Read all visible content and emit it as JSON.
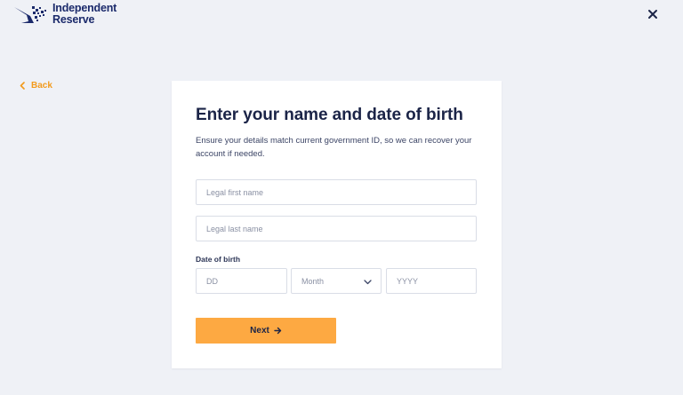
{
  "brand": {
    "name_line1": "Independent",
    "name_line2": "Reserve",
    "logo_icon": "eagle-wing-icon",
    "color": "#1b2a6b"
  },
  "header": {
    "close_icon": "close-icon"
  },
  "nav": {
    "back_label": "Back",
    "back_icon": "chevron-left-icon"
  },
  "form": {
    "title": "Enter your name and date of birth",
    "description": "Ensure your details match current government ID, so we can recover your account if needed.",
    "first_name": {
      "placeholder": "Legal first name",
      "value": ""
    },
    "last_name": {
      "placeholder": "Legal last name",
      "value": ""
    },
    "dob": {
      "label": "Date of birth",
      "day_placeholder": "DD",
      "month_value": "Month",
      "month_icon": "chevron-down-icon",
      "year_placeholder": "YYYY"
    },
    "next_label": "Next",
    "next_icon": "arrow-right-icon"
  },
  "colors": {
    "background": "#eff1f6",
    "accent": "#fda942",
    "link": "#f29a1c",
    "heading": "#1b2447"
  }
}
